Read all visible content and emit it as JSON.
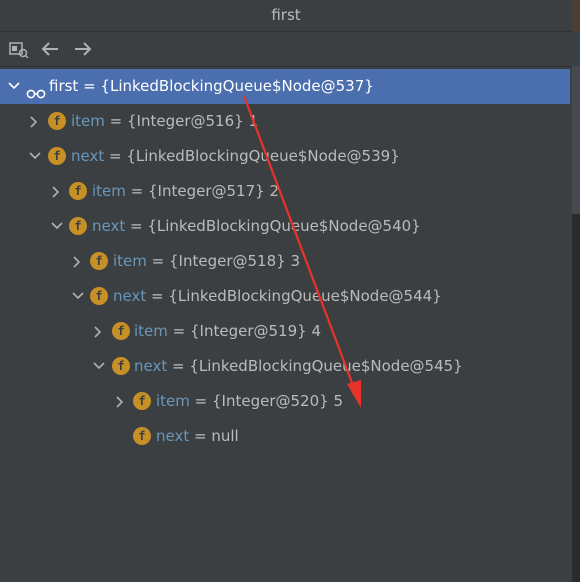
{
  "window": {
    "title": "first"
  },
  "toolbar": {
    "icons": [
      "evaluate-icon",
      "back-arrow-icon",
      "forward-arrow-icon"
    ]
  },
  "tree": {
    "rows": [
      {
        "name": "first",
        "eq": " = ",
        "value": "{LinkedBlockingQueue$Node@537}",
        "icon": "watch-glasses-icon",
        "expanded": true
      },
      {
        "name": "item",
        "eq": " = ",
        "value": "{Integer@516} 1",
        "icon": "field-icon",
        "expanded": false
      },
      {
        "name": "next",
        "eq": " = ",
        "value": "{LinkedBlockingQueue$Node@539}",
        "icon": "field-icon",
        "expanded": true
      },
      {
        "name": "item",
        "eq": " = ",
        "value": "{Integer@517} 2",
        "icon": "field-icon",
        "expanded": false
      },
      {
        "name": "next",
        "eq": " = ",
        "value": "{LinkedBlockingQueue$Node@540}",
        "icon": "field-icon",
        "expanded": true
      },
      {
        "name": "item",
        "eq": " = ",
        "value": "{Integer@518} 3",
        "icon": "field-icon",
        "expanded": false
      },
      {
        "name": "next",
        "eq": " = ",
        "value": "{LinkedBlockingQueue$Node@544}",
        "icon": "field-icon",
        "expanded": true
      },
      {
        "name": "item",
        "eq": " = ",
        "value": "{Integer@519} 4",
        "icon": "field-icon",
        "expanded": false
      },
      {
        "name": "next",
        "eq": " = ",
        "value": "{LinkedBlockingQueue$Node@545}",
        "icon": "field-icon",
        "expanded": true
      },
      {
        "name": "item",
        "eq": " = ",
        "value": "{Integer@520} 5",
        "icon": "field-icon",
        "expanded": false
      },
      {
        "name": "next",
        "eq": " = ",
        "value": "null",
        "icon": "field-icon",
        "expanded": null
      }
    ],
    "field_badge": "f"
  },
  "colors": {
    "background": "#3c3f41",
    "selection": "#4b6eaf",
    "field_name": "#6897bb",
    "field_badge": "#c69026",
    "annotation_arrow": "#e8332a"
  }
}
